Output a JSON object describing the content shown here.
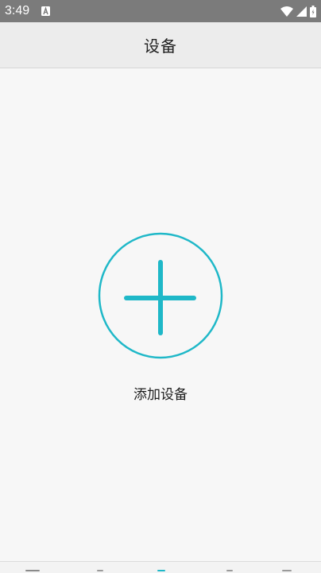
{
  "status_bar": {
    "time": "3:49",
    "notification_icon": "a-box-icon",
    "wifi_icon": "wifi-icon",
    "signal_icon": "cell-signal-icon",
    "battery_icon": "battery-icon"
  },
  "header": {
    "title": "设备"
  },
  "main": {
    "add_icon": "plus-circle-icon",
    "add_label": "添加设备"
  },
  "colors": {
    "accent": "#1fb8c8",
    "status_bar": "#7b7b7b",
    "header_bg": "#ececec",
    "page_bg": "#f7f7f7"
  }
}
